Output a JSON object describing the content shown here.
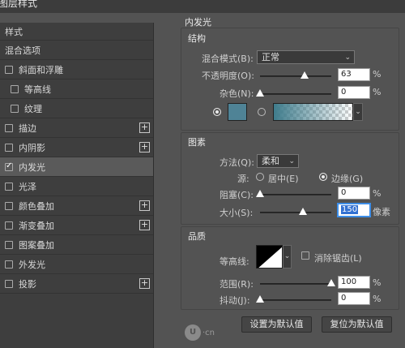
{
  "window": {
    "title": "图层样式"
  },
  "sidebar": {
    "header": "样式",
    "items": [
      {
        "label": "混合选项"
      },
      {
        "label": "斜面和浮雕"
      },
      {
        "label": "等高线"
      },
      {
        "label": "纹理"
      },
      {
        "label": "描边"
      },
      {
        "label": "内阴影"
      },
      {
        "label": "内发光"
      },
      {
        "label": "光泽"
      },
      {
        "label": "颜色叠加"
      },
      {
        "label": "渐变叠加"
      },
      {
        "label": "图案叠加"
      },
      {
        "label": "外发光"
      },
      {
        "label": "投影"
      }
    ],
    "checked": [
      "内发光"
    ],
    "selected": "内发光"
  },
  "panel": {
    "title": "内发光",
    "structure": {
      "title": "结构",
      "blend_mode_label": "混合模式(B):",
      "blend_mode_value": "正常",
      "opacity_label": "不透明度(O):",
      "opacity_value": "63",
      "opacity_fraction": 0.63,
      "noise_label": "杂色(N):",
      "noise_value": "0",
      "noise_fraction": 0,
      "percent": "%",
      "glow_color": "#4f8396",
      "gradient_from": "#3f7c8c",
      "gradient_to": "#ffffff"
    },
    "elements": {
      "title": "图素",
      "technique_label": "方法(Q):",
      "technique_value": "柔和",
      "source_label": "源:",
      "source_center_label": "居中(E)",
      "source_edge_label": "边缘(G)",
      "source_selected": "edge",
      "choke_label": "阻塞(C):",
      "choke_value": "0",
      "choke_fraction": 0,
      "size_label": "大小(S):",
      "size_value": "150",
      "size_fraction": 0.6,
      "size_unit": "像素"
    },
    "quality": {
      "title": "品质",
      "contour_label": "等高线:",
      "antialias_label": "消除锯齿(L)",
      "antialias_checked": false,
      "range_label": "范围(R):",
      "range_value": "100",
      "range_fraction": 1.0,
      "jitter_label": "抖动(J):",
      "jitter_value": "0",
      "jitter_fraction": 0
    },
    "buttons": {
      "set_default": "设置为默认值",
      "reset_default": "复位为默认值"
    }
  },
  "watermark": {
    "logo_text": "UI·CN"
  }
}
